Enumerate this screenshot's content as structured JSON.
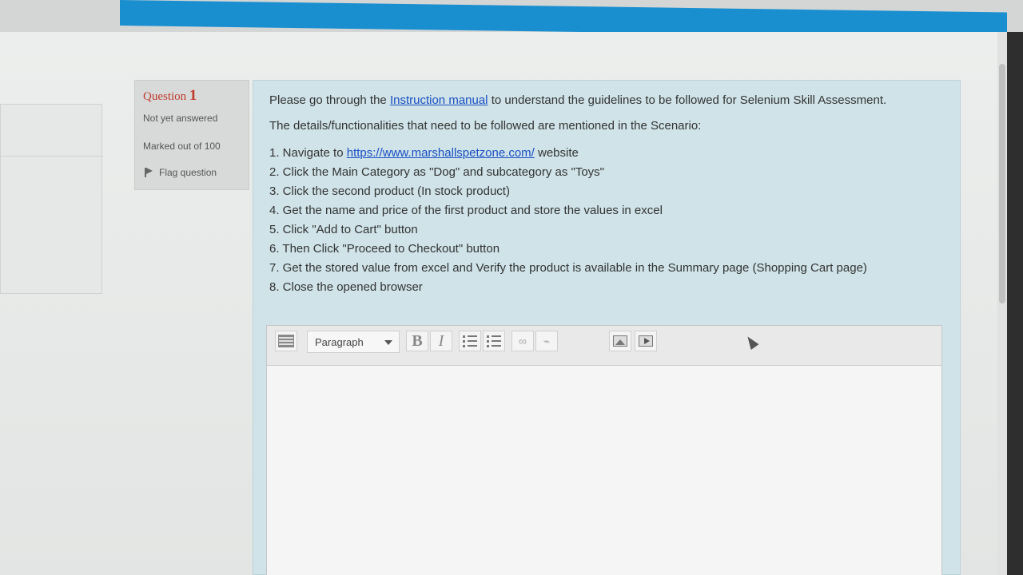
{
  "question": {
    "label": "Question",
    "number": "1",
    "state": "Not yet answered",
    "grade": "Marked out of 100",
    "flag_label": "Flag question"
  },
  "content": {
    "intro_before": "Please go through the ",
    "intro_link": "Instruction manual",
    "intro_after": " to understand the guidelines to be followed for Selenium Skill Assessment.",
    "details": "The details/functionalities that need to be followed are mentioned in the Scenario:",
    "step1_before": "1. Navigate to ",
    "step1_link": "https://www.marshallspetzone.com/",
    "step1_after": " website",
    "step2": "2. Click the Main Category as \"Dog\" and subcategory as \"Toys\"",
    "step3": "3. Click the second product (In stock product)",
    "step4": "4. Get the name and price of the first product and store the values in excel",
    "step5": "5. Click \"Add to Cart\" button",
    "step6": "6. Then Click \"Proceed to Checkout\" button",
    "step7": "7. Get the stored value from excel and Verify the product is available in the Summary page (Shopping Cart page)",
    "step8": "8. Close the opened browser"
  },
  "editor": {
    "format_select": "Paragraph",
    "bold_label": "B",
    "italic_label": "I",
    "icons": [
      "kitchen-sink-icon",
      "bold-icon",
      "italic-icon",
      "unordered-list-icon",
      "ordered-list-icon",
      "link-icon",
      "unlink-icon",
      "image-icon",
      "media-icon"
    ],
    "body_text": ""
  },
  "colors": {
    "top_bar": "#1a8fd0",
    "content_bg": "#cfe3e8",
    "question_red": "#c0392b",
    "link_blue": "#1a4fc4"
  }
}
